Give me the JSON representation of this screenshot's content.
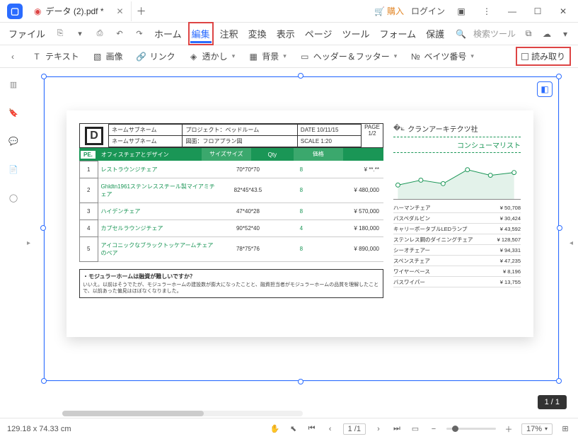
{
  "window": {
    "tab_title": "データ (2).pdf *",
    "buy": "購入",
    "login": "ログイン"
  },
  "menu": {
    "file": "ファイル",
    "home": "ホーム",
    "edit": "編集",
    "annotate": "注釈",
    "convert": "変換",
    "view": "表示",
    "page": "ページ",
    "tool": "ツール",
    "form": "フォーム",
    "protect": "保護",
    "search_ph": "検索ツール"
  },
  "etool": {
    "text": "テキスト",
    "image": "画像",
    "link": "リンク",
    "watermark": "透かし",
    "background": "背景",
    "headerfooter": "ヘッダー＆フッター",
    "bates": "ベイツ番号",
    "readmode": "読み取り"
  },
  "doc": {
    "header": {
      "name_sub": "ネームサブネーム",
      "project": "プロジェクト：ベッドルーム",
      "drawing": "図面：フロアプラン図",
      "date": "DATE 10/11/15",
      "scale": "SCALE 1:20",
      "page_lbl": "PAGE",
      "page_val": "1/2"
    },
    "cols": {
      "pe": "PE.",
      "name": "オフィスチェアとデザイン",
      "size": "サイズサイズ",
      "qty": "Qty",
      "price": "価格"
    },
    "rows": [
      {
        "idx": "1",
        "name": "レストラウンジチェア",
        "size": "70*70*70",
        "qty": "8",
        "price": "¥ **.**"
      },
      {
        "idx": "2",
        "name": "Ghldtn1961ステンレススチール製マイアミチェア",
        "size": "82*45*43.5",
        "qty": "8",
        "price": "¥ 480,000"
      },
      {
        "idx": "3",
        "name": "ハイデンチェア",
        "size": "47*40*28",
        "qty": "8",
        "price": "¥ 570,000"
      },
      {
        "idx": "4",
        "name": "カプセルラウンジチェア",
        "size": "90*52*40",
        "qty": "4",
        "price": "¥ 180,000"
      },
      {
        "idx": "5",
        "name": "アイコニックなブラックトッケアームチェアのペア",
        "size": "78*75*76",
        "qty": "8",
        "price": "¥ 890,000"
      }
    ],
    "q": {
      "title": "・モジュラーホームは融資が難しいですか？",
      "body": "いいえ。以前はそうでたが、モジュラーホームの建設数が膨大になったことと、融資担当者がモジュラーホームの品質を理解したことで、以前あった偏見はほぼなくなりました。"
    },
    "side": {
      "company": "クランアーキテクツ社",
      "consumer": "コンシューマリスト",
      "items": [
        {
          "n": "ハーマンチェア",
          "p": "¥ 50,708"
        },
        {
          "n": "バスペダルビン",
          "p": "¥ 30,424"
        },
        {
          "n": "キャリーポータブルLEDランプ",
          "p": "¥ 43,592"
        },
        {
          "n": "ステンレス鋼のダイニングチェア",
          "p": "¥ 128,507"
        },
        {
          "n": "シーオチェアー",
          "p": "¥ 94,331"
        },
        {
          "n": "スペンスチェア",
          "p": "¥ 47,235"
        },
        {
          "n": "ワイヤーベース",
          "p": "¥ 8,196"
        },
        {
          "n": "バスワイパー",
          "p": "¥ 13,755"
        }
      ]
    }
  },
  "status": {
    "coords": "129.18 x 74.33 cm",
    "page": "1 /1",
    "pagenum": "1 / 1",
    "zoom": "17%"
  },
  "chart_data": {
    "type": "line",
    "x": [
      1,
      2,
      3,
      4,
      5,
      6
    ],
    "values": [
      28,
      35,
      30,
      48,
      40,
      45
    ],
    "ylim": [
      0,
      60
    ]
  }
}
